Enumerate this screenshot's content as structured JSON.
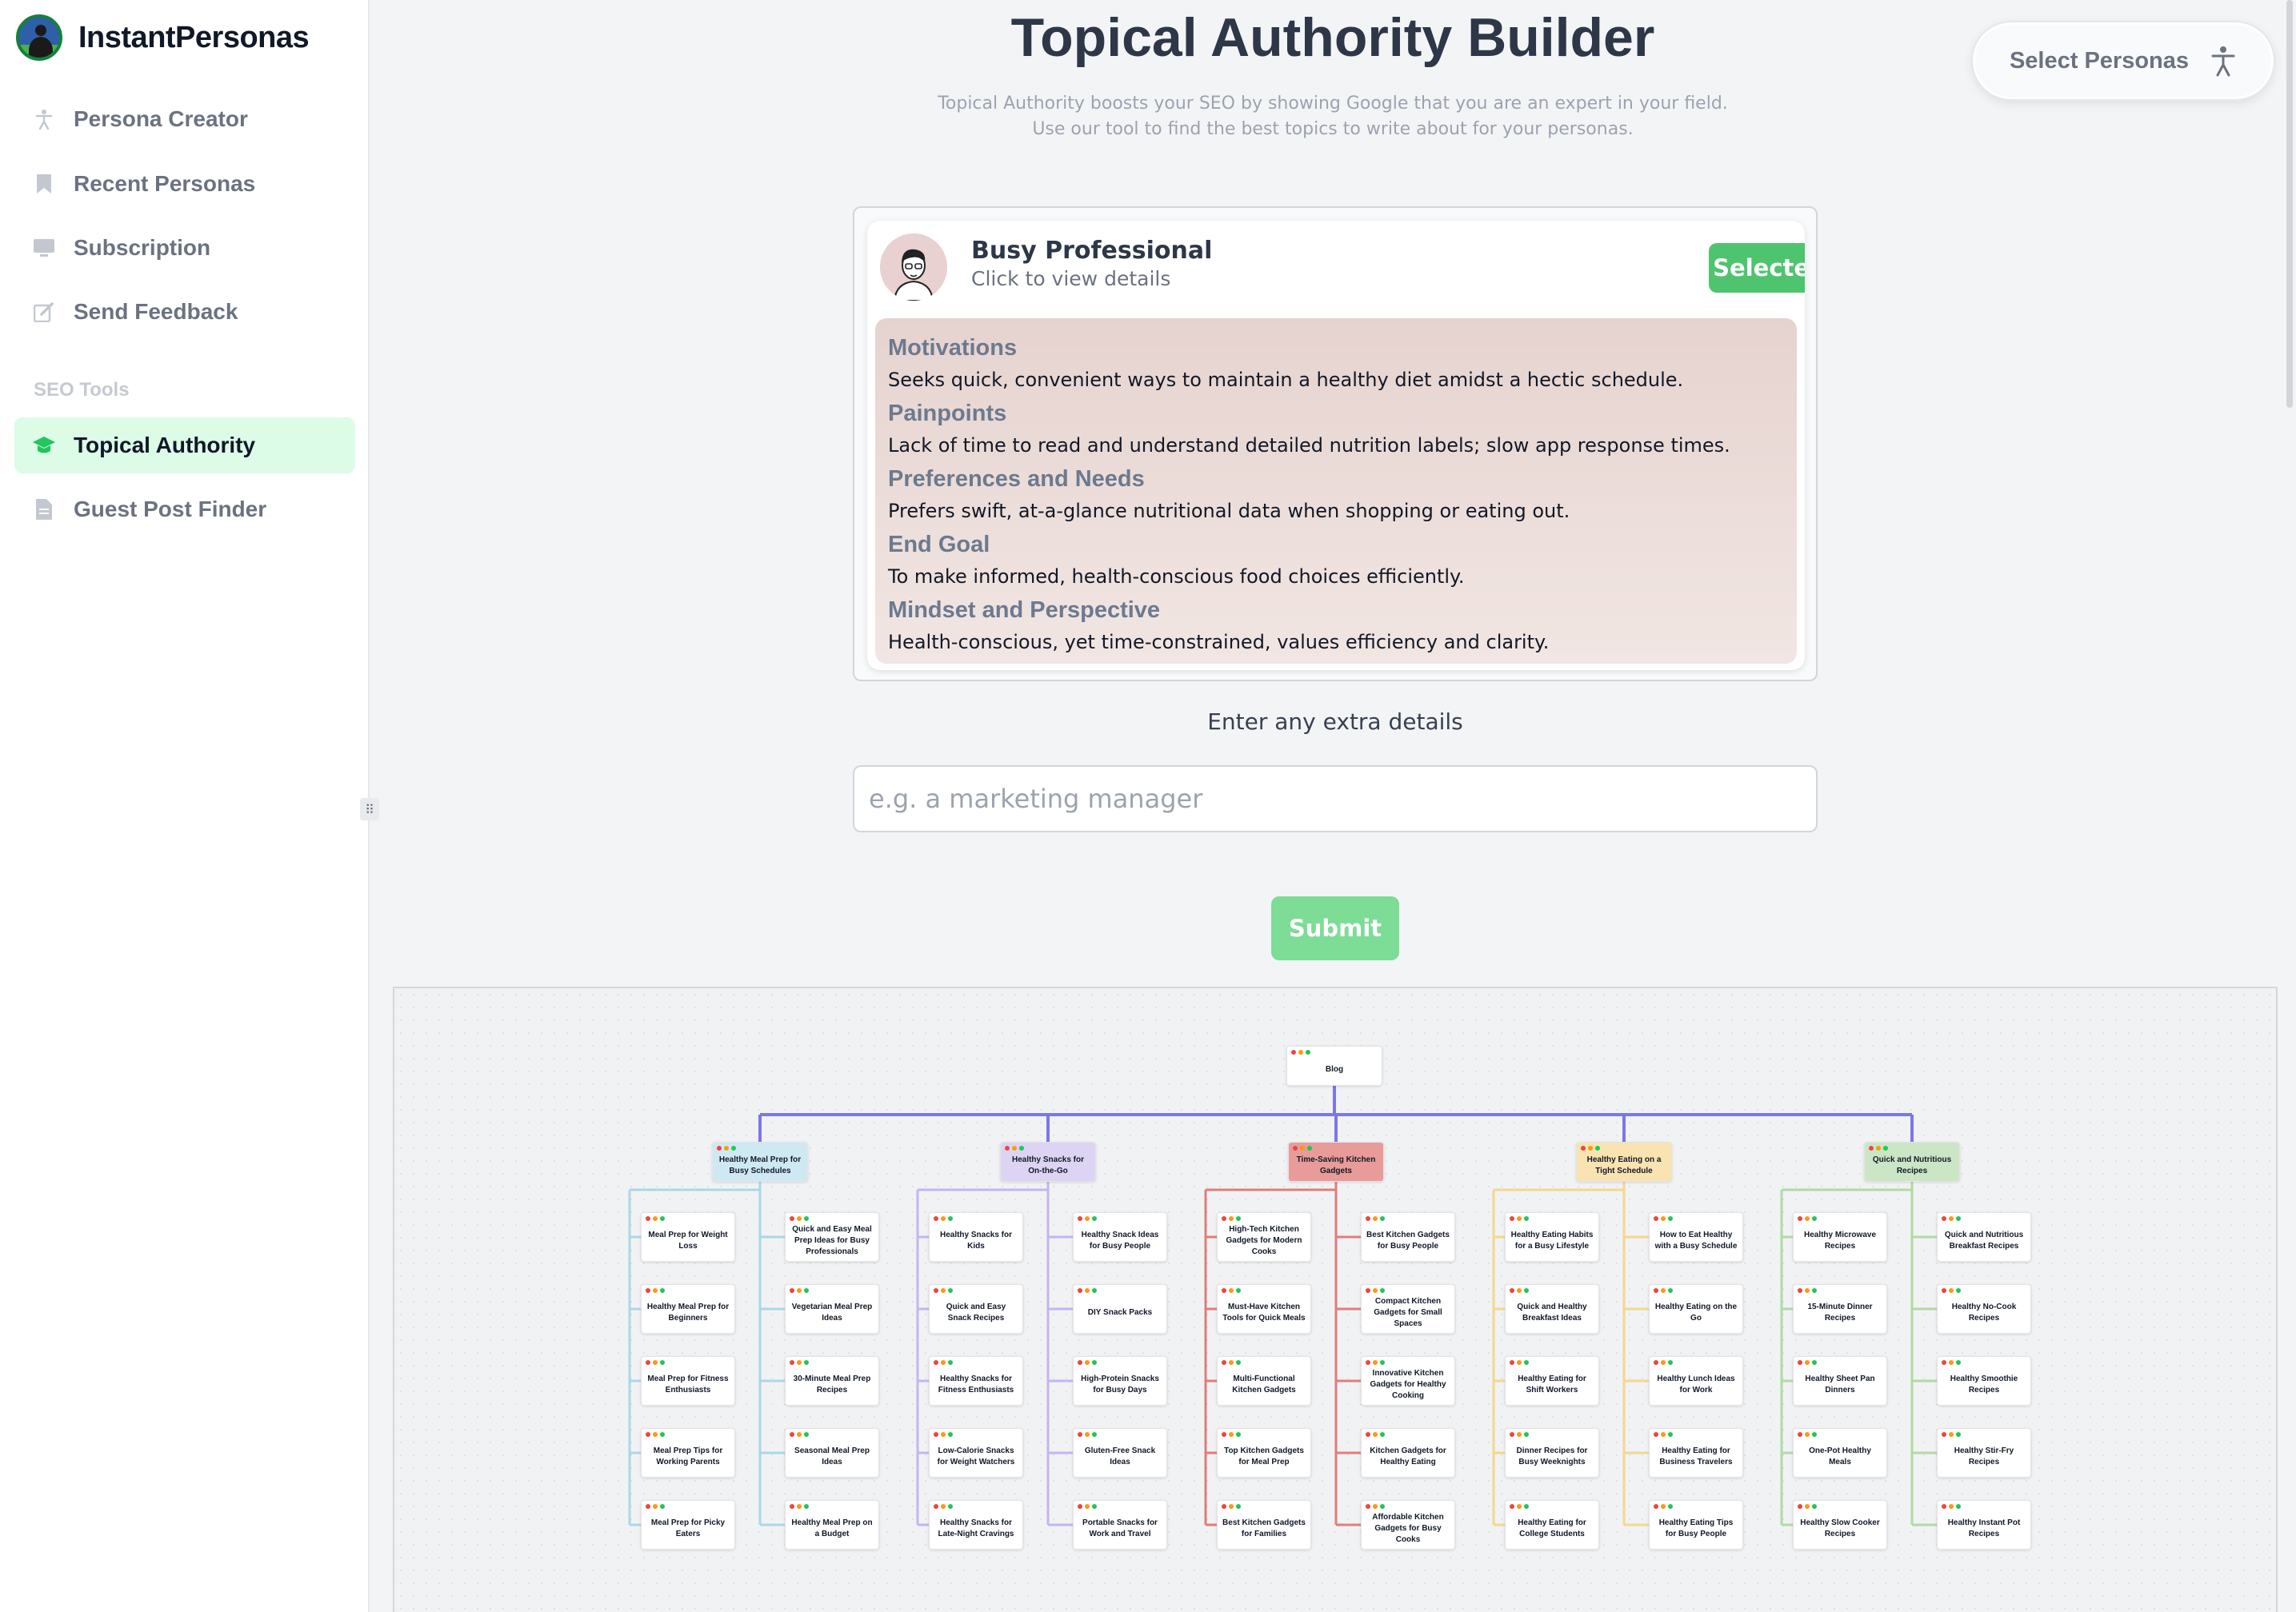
{
  "app": {
    "name": "InstantPersonas"
  },
  "sidebar": {
    "items": [
      {
        "label": "Persona Creator",
        "icon": "accessibility-icon"
      },
      {
        "label": "Recent Personas",
        "icon": "bookmark-icon"
      },
      {
        "label": "Subscription",
        "icon": "monitor-icon"
      },
      {
        "label": "Send Feedback",
        "icon": "edit-icon"
      }
    ],
    "section_label": "SEO Tools",
    "seo_items": [
      {
        "label": "Topical Authority",
        "icon": "graduation-cap-icon",
        "active": true
      },
      {
        "label": "Guest Post Finder",
        "icon": "document-icon",
        "active": false
      }
    ]
  },
  "header": {
    "title": "Topical Authority Builder",
    "subtitle_line1": "Topical Authority boosts your SEO by showing Google that you are an expert in your field.",
    "subtitle_line2": "Use our tool to find the best topics to write about for your personas.",
    "select_personas_label": "Select Personas"
  },
  "persona": {
    "name": "Busy Professional",
    "hint": "Click to view details",
    "badge": "Selected",
    "details": [
      {
        "heading": "Motivations",
        "text": "Seeks quick, convenient ways to maintain a healthy diet amidst a hectic schedule."
      },
      {
        "heading": "Painpoints",
        "text": "Lack of time to read and understand detailed nutrition labels; slow app response times."
      },
      {
        "heading": "Preferences and Needs",
        "text": "Prefers swift, at-a-glance nutritional data when shopping or eating out."
      },
      {
        "heading": "End Goal",
        "text": "To make informed, health-conscious food choices efficiently."
      },
      {
        "heading": "Mindset and Perspective",
        "text": "Health-conscious, yet time-constrained, values efficiency and clarity."
      }
    ]
  },
  "form": {
    "extra_label": "Enter any extra details",
    "extra_placeholder": "e.g. a marketing manager",
    "submit_label": "Submit"
  },
  "colors": {
    "accent": "#4ec46f",
    "submit": "#7ddc95",
    "root_line": "#7b78e6"
  },
  "tree": {
    "root": "Blog",
    "categories": [
      {
        "name": "Healthy Meal Prep for Busy Schedules",
        "color": "#cfe9f3",
        "line": "#a9d8e8",
        "columns": [
          [
            "Meal Prep for Weight Loss",
            "Healthy Meal Prep for Beginners",
            "Meal Prep for Fitness Enthusiasts",
            "Meal Prep Tips for Working Parents",
            "Meal Prep for Picky Eaters"
          ],
          [
            "Quick and Easy Meal Prep Ideas for Busy Professionals",
            "Vegetarian Meal Prep Ideas",
            "30-Minute Meal Prep Recipes",
            "Seasonal Meal Prep Ideas",
            "Healthy Meal Prep on a Budget"
          ]
        ]
      },
      {
        "name": "Healthy Snacks for On-the-Go",
        "color": "#ddd4f3",
        "line": "#c4b5ef",
        "columns": [
          [
            "Healthy Snacks for Kids",
            "Quick and Easy Snack Recipes",
            "Healthy Snacks for Fitness Enthusiasts",
            "Low-Calorie Snacks for Weight Watchers",
            "Healthy Snacks for Late-Night Cravings"
          ],
          [
            "Healthy Snack Ideas for Busy People",
            "DIY Snack Packs",
            "High-Protein Snacks for Busy Days",
            "Gluten-Free Snack Ideas",
            "Portable Snacks for Work and Travel"
          ]
        ]
      },
      {
        "name": "Time-Saving Kitchen Gadgets",
        "color": "#e89b98",
        "line": "#e07e79",
        "columns": [
          [
            "High-Tech Kitchen Gadgets for Modern Cooks",
            "Must-Have Kitchen Tools for Quick Meals",
            "Multi-Functional Kitchen Gadgets",
            "Top Kitchen Gadgets for Meal Prep",
            "Best Kitchen Gadgets for Families"
          ],
          [
            "Best Kitchen Gadgets for Busy People",
            "Compact Kitchen Gadgets for Small Spaces",
            "Innovative Kitchen Gadgets for Healthy Cooking",
            "Kitchen Gadgets for Healthy Eating",
            "Affordable Kitchen Gadgets for Busy Cooks"
          ]
        ]
      },
      {
        "name": "Healthy Eating on a Tight Schedule",
        "color": "#f8e3b1",
        "line": "#f4d78e",
        "columns": [
          [
            "Healthy Eating Habits for a Busy Lifestyle",
            "Quick and Healthy Breakfast Ideas",
            "Healthy Eating for Shift Workers",
            "Dinner Recipes for Busy Weeknights",
            "Healthy Eating for College Students"
          ],
          [
            "How to Eat Healthy with a Busy Schedule",
            "Healthy Eating on the Go",
            "Healthy Lunch Ideas for Work",
            "Healthy Eating for Business Travelers",
            "Healthy Eating Tips for Busy People"
          ]
        ]
      },
      {
        "name": "Quick and Nutritious Recipes",
        "color": "#cbe6c4",
        "line": "#b0dba5",
        "columns": [
          [
            "Healthy Microwave Recipes",
            "15-Minute Dinner Recipes",
            "Healthy Sheet Pan Dinners",
            "One-Pot Healthy Meals",
            "Healthy Slow Cooker Recipes"
          ],
          [
            "Quick and Nutritious Breakfast Recipes",
            "Healthy No-Cook Recipes",
            "Healthy Smoothie Recipes",
            "Healthy Stir-Fry Recipes",
            "Healthy Instant Pot Recipes"
          ]
        ]
      }
    ]
  }
}
